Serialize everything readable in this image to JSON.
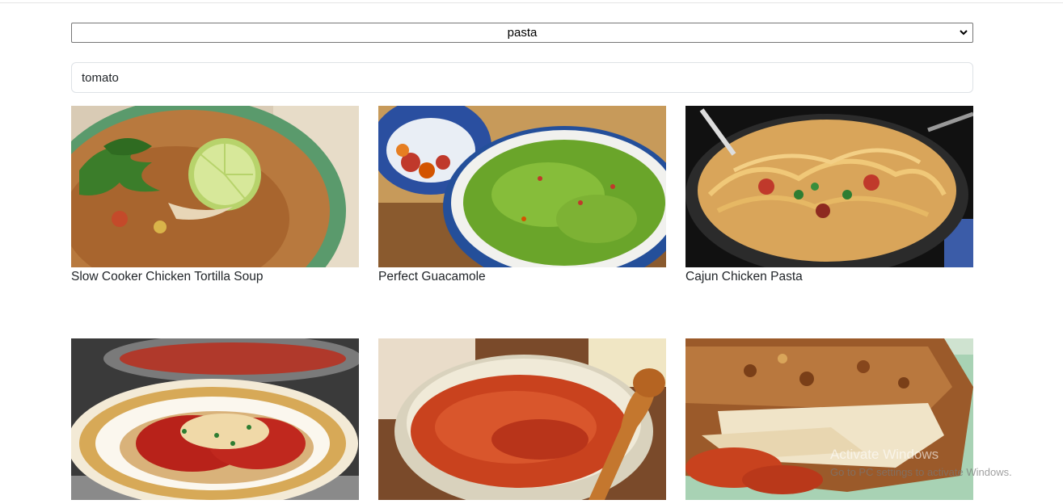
{
  "filter": {
    "selected": "pasta"
  },
  "search": {
    "value": "tomato"
  },
  "recipes": [
    {
      "title": "Slow Cooker Chicken Tortilla Soup",
      "image": "soup-photo"
    },
    {
      "title": "Perfect Guacamole",
      "image": "guacamole-photo"
    },
    {
      "title": "Cajun Chicken Pasta",
      "image": "pasta-photo"
    },
    {
      "title": "",
      "image": "chicken-parmesan-photo"
    },
    {
      "title": "",
      "image": "marinara-sauce-photo"
    },
    {
      "title": "",
      "image": "lasagna-photo"
    }
  ],
  "watermark": {
    "title": "Activate Windows",
    "subtitle": "Go to PC settings to activate Windows."
  }
}
